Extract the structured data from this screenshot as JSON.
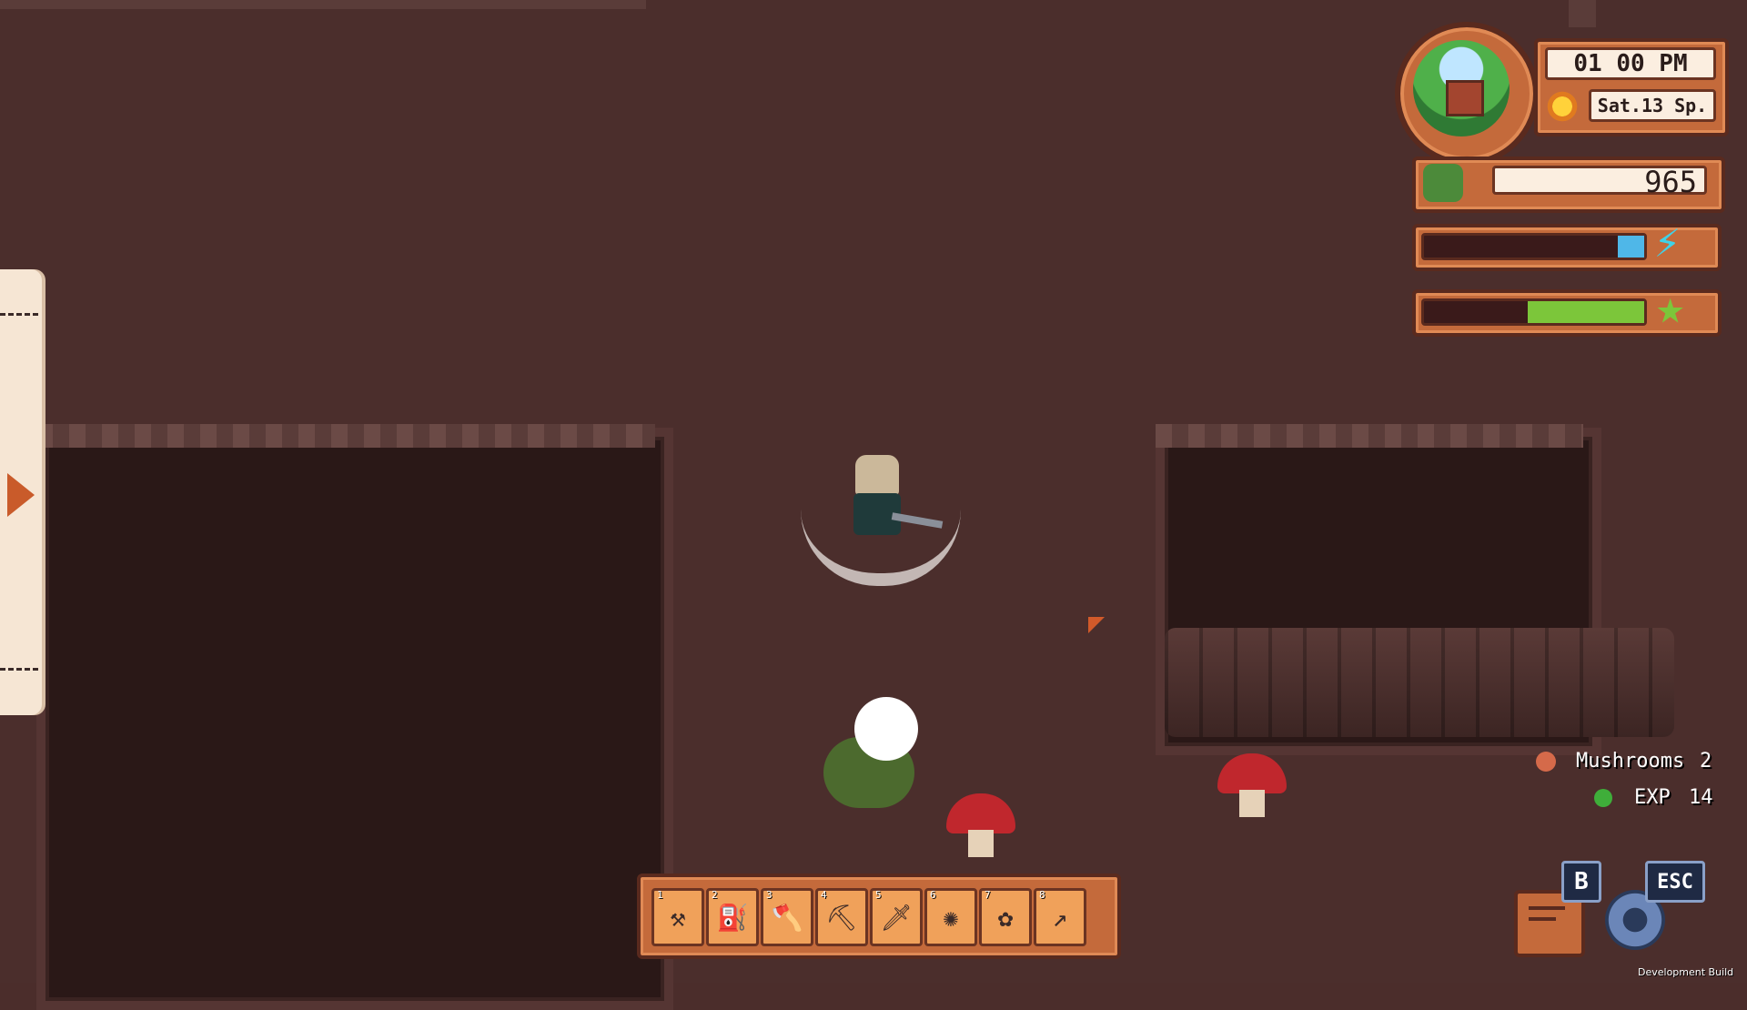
{
  "hud": {
    "time": "01  00 PM",
    "date": "Sat.13 Sp.",
    "money": "965",
    "energy_fraction": 0.12,
    "health_fraction": 0.53
  },
  "pickups": [
    {
      "icon": "mushroom-icon",
      "label": "Mushrooms",
      "count": "2"
    },
    {
      "icon": "exp-orb-icon",
      "label": "EXP",
      "count": "14"
    }
  ],
  "hotbar": {
    "slots": [
      {
        "num": "1",
        "icon": "hammer-icon",
        "glyph": "⚒"
      },
      {
        "num": "2",
        "icon": "watering-can-icon",
        "glyph": "⛽"
      },
      {
        "num": "3",
        "icon": "axe-icon",
        "glyph": "🪓"
      },
      {
        "num": "4",
        "icon": "pickaxe-icon",
        "glyph": "⛏"
      },
      {
        "num": "5",
        "icon": "sword-icon",
        "glyph": "🗡"
      },
      {
        "num": "6",
        "icon": "seed-bag-icon",
        "glyph": "✺"
      },
      {
        "num": "7",
        "icon": "flower-seeds-icon",
        "glyph": "✿"
      },
      {
        "num": "8",
        "icon": "fishing-rod-icon",
        "glyph": "↗"
      }
    ]
  },
  "shortcuts": {
    "journal_key": "B",
    "menu_key": "ESC"
  },
  "build_label": "Development Build",
  "colors": {
    "energy": "#4fb7e8",
    "health": "#7cc63a",
    "frame": "#c46a3b"
  }
}
